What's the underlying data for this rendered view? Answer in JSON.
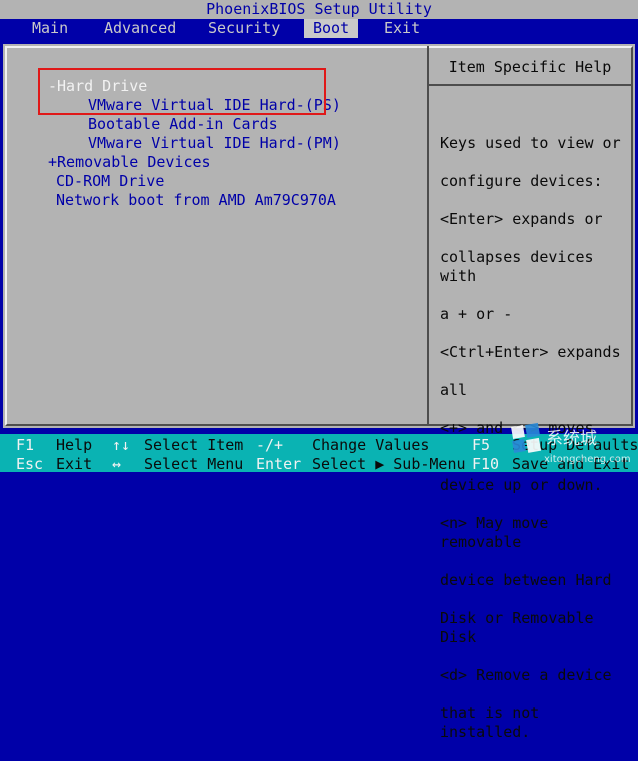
{
  "window": {
    "title": "PhoenixBIOS Setup Utility"
  },
  "menu": [
    {
      "label": "Main"
    },
    {
      "label": "Advanced"
    },
    {
      "label": "Security"
    },
    {
      "label": "Boot",
      "active": true
    },
    {
      "label": "Exit"
    }
  ],
  "boot_list": [
    {
      "label": "-Hard Drive",
      "selected": true
    },
    {
      "label": "VMware Virtual IDE Hard-(PS)"
    },
    {
      "label": "Bootable Add-in Cards"
    },
    {
      "label": "VMware Virtual IDE Hard-(PM)"
    },
    {
      "label": "+Removable Devices"
    },
    {
      "label": "CD-ROM Drive"
    },
    {
      "label": "Network boot from AMD Am79C970A"
    }
  ],
  "help": {
    "title": "Item Specific Help",
    "lines": [
      "Keys used to view or",
      "configure devices:",
      "<Enter> expands or",
      "collapses devices with",
      "a + or -",
      "<Ctrl+Enter> expands",
      "all",
      "<+> and <-> moves the",
      "device up or down.",
      "<n> May move removable",
      "device between Hard",
      "Disk or Removable Disk",
      "<d> Remove a device",
      "that is not installed."
    ]
  },
  "footer": {
    "row1": [
      {
        "key": "F1",
        "desc": "Help"
      },
      {
        "key": "↑↓",
        "desc": "Select Item"
      },
      {
        "key": "-/+",
        "desc": "Change Values"
      },
      {
        "key": "F5",
        "desc": "Setup Defaults"
      }
    ],
    "row2": [
      {
        "key": "Esc",
        "desc": "Exit"
      },
      {
        "key": "↔",
        "desc": "Select Menu"
      },
      {
        "key": "Enter",
        "desc": "Select ▶ Sub-Menu"
      },
      {
        "key": "F10",
        "desc": "Save and Exit"
      }
    ]
  },
  "watermark": {
    "text": "系统城",
    "url": "xitongcheng.com"
  },
  "colors": {
    "background": "#0000a8",
    "panel": "#b3b3b3",
    "footer": "#0ab3b3",
    "highlight_box": "#e01818"
  }
}
